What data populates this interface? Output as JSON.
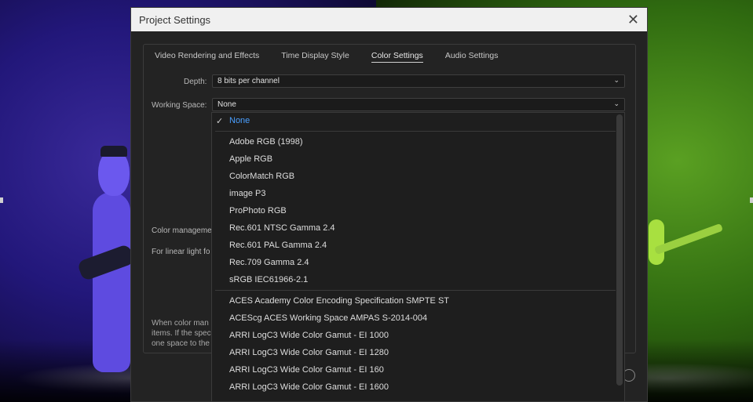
{
  "dialog": {
    "title": "Project Settings",
    "tabs": [
      {
        "label": "Video Rendering and Effects",
        "active": false
      },
      {
        "label": "Time Display Style",
        "active": false
      },
      {
        "label": "Color Settings",
        "active": true
      },
      {
        "label": "Audio Settings",
        "active": false
      }
    ],
    "depth": {
      "label": "Depth:",
      "value": "8 bits per channel"
    },
    "working_space": {
      "label": "Working Space:",
      "value": "None"
    },
    "partial_labels": {
      "color_management": "Color manageme",
      "linear_light": "For linear light fo"
    },
    "help_text": [
      "When color man",
      "items. If the spec",
      "one space to the"
    ]
  },
  "dropdown": {
    "selected": "None",
    "group1": [
      "None"
    ],
    "group2": [
      "Adobe RGB (1998)",
      "Apple RGB",
      "ColorMatch RGB",
      "image P3",
      "ProPhoto RGB",
      "Rec.601 NTSC Gamma 2.4",
      "Rec.601 PAL Gamma 2.4",
      "Rec.709 Gamma 2.4",
      "sRGB IEC61966-2.1"
    ],
    "group3": [
      "ACES Academy Color Encoding Specification SMPTE ST",
      "ACEScg ACES Working Space AMPAS S-2014-004",
      "ARRI LogC3 Wide Color Gamut - EI 1000",
      "ARRI LogC3 Wide Color Gamut - EI 1280",
      "ARRI LogC3 Wide Color Gamut - EI 160",
      "ARRI LogC3 Wide Color Gamut - EI 1600"
    ]
  },
  "icons": {
    "close": "close-icon",
    "chevron": "chevron-down-icon",
    "check": "checkmark-icon"
  },
  "colors": {
    "selected_item": "#4a9fff",
    "dialog_bg": "#232323",
    "titlebar_bg": "#f0f0f0"
  }
}
